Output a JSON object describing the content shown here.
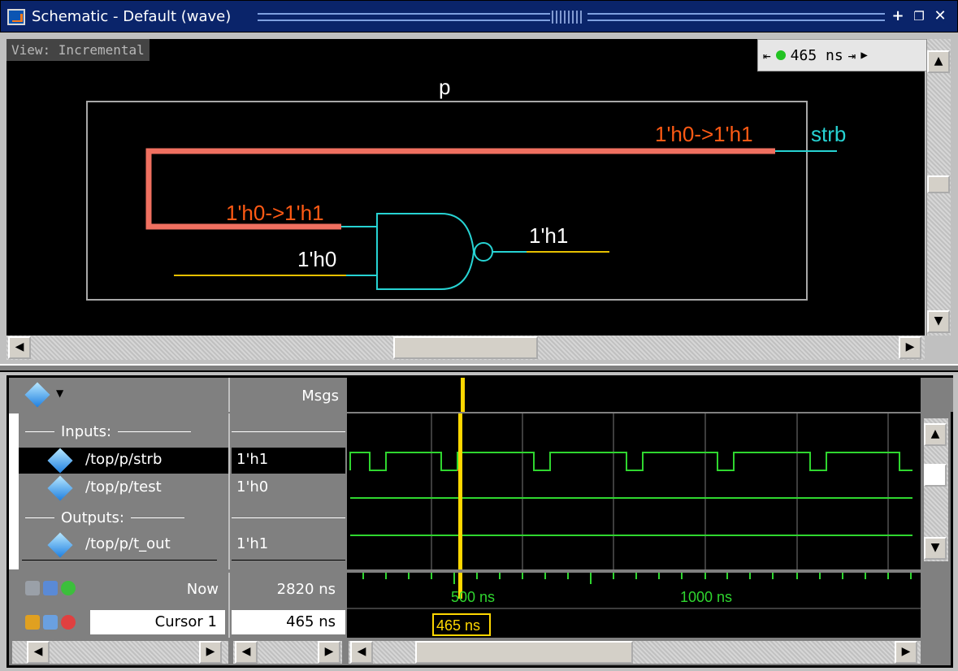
{
  "window": {
    "title": "Schematic - Default (wave)",
    "buttons": [
      "+",
      "❐",
      "✕"
    ]
  },
  "schematic": {
    "view_label": "View: Incremental",
    "time_readout": "465 ns",
    "module_name": "p",
    "labels": {
      "top_wire": "1'h0->1'h1",
      "port_out": "strb",
      "gate_in1": "1'h0->1'h1",
      "gate_in2": "1'h0",
      "gate_out": "1'h1"
    },
    "colors": {
      "active_wire": "#f07060",
      "wire": "#e6c000",
      "gate": "#27d3d3",
      "label_change": "#ff5a14",
      "label_value": "#ffffff"
    }
  },
  "wave": {
    "header": {
      "msgs_label": "Msgs"
    },
    "rows": [
      {
        "type": "group",
        "name": "Inputs:"
      },
      {
        "type": "signal",
        "name": "/top/p/strb",
        "value": "1'h1",
        "selected": true
      },
      {
        "type": "signal",
        "name": "/top/p/test",
        "value": "1'h0",
        "selected": false
      },
      {
        "type": "group",
        "name": "Outputs:"
      },
      {
        "type": "signal",
        "name": "/top/p/t_out",
        "value": "1'h1",
        "selected": false
      }
    ],
    "footer": {
      "now_label": "Now",
      "now_value": "2820 ns",
      "cursor_label": "Cursor 1",
      "cursor_value": "465 ns",
      "tick_500": "500 ns",
      "tick_1000": "1000 ns",
      "cursor_flag": "465 ns"
    },
    "colors": {
      "wave": "#2fd62f",
      "cursor": "#ffd700"
    }
  }
}
